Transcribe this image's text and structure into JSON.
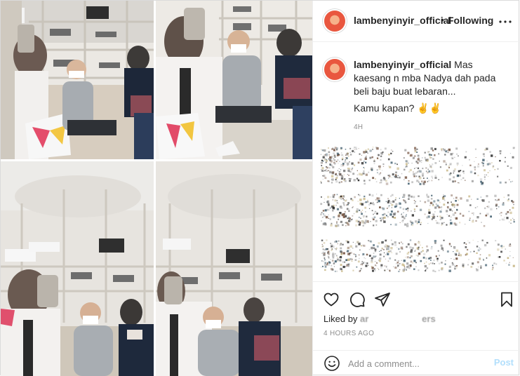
{
  "header": {
    "username": "lambenyinyir_official",
    "separator": "•",
    "follow_status": "Following",
    "more_icon": "more-horizontal-icon"
  },
  "caption": {
    "username": "lambenyinyir_official",
    "text": "Mas kaesang n mba Nadya dah pada beli baju buat lebaran...",
    "second_line": "Kamu kapan? ✌️✌️",
    "time": "4h"
  },
  "actions": {
    "like_icon": "heart-icon",
    "comment_icon": "comment-bubble-icon",
    "share_icon": "paper-plane-icon",
    "save_icon": "bookmark-icon",
    "liked_by_prefix": "Liked by",
    "liked_by_names": "ar                     ers",
    "post_time": "4 HOURS AGO"
  },
  "add_comment": {
    "emoji_icon": "emoji-smile-icon",
    "placeholder": "Add a comment...",
    "post_label": "Post"
  },
  "colors": {
    "post_button_disabled": "#b2dffc",
    "muted_text": "#8e8e8e",
    "avatar_ring": "#e9573f"
  }
}
